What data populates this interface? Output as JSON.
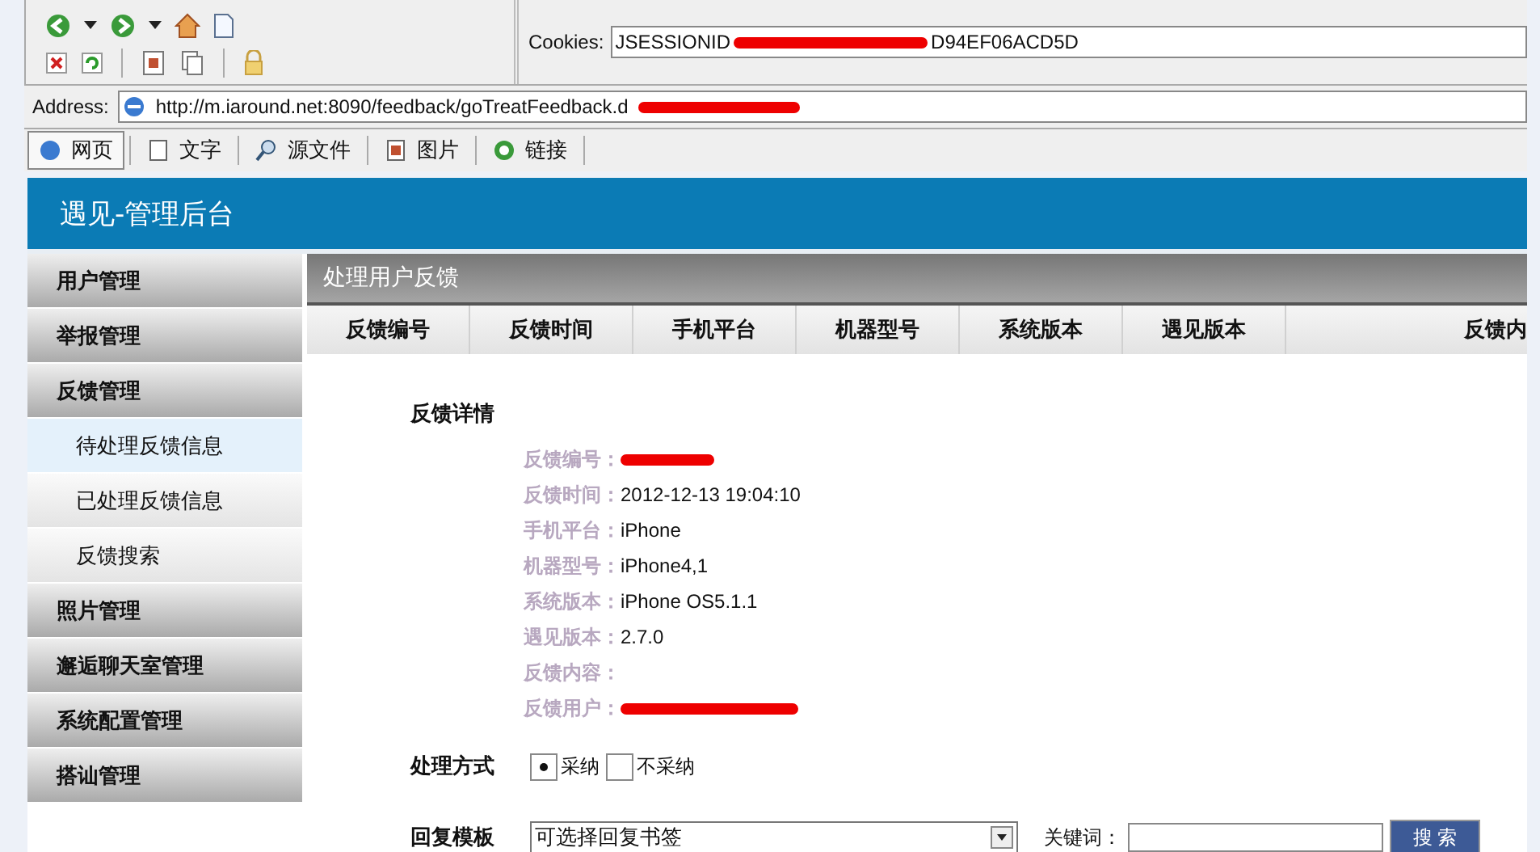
{
  "browser": {
    "cookies_label": "Cookies:",
    "cookies_value_start": "JSESSIONID",
    "cookies_value_end": "D94EF06ACD5D",
    "address_label": "Address:",
    "address_value": "http://m.iaround.net:8090/feedback/goTreatFeedback.d",
    "view_tabs": [
      {
        "label": "网页",
        "selected": true,
        "kind": "page"
      },
      {
        "label": "文字",
        "selected": false,
        "kind": "text"
      },
      {
        "label": "源文件",
        "selected": false,
        "kind": "source"
      },
      {
        "label": "图片",
        "selected": false,
        "kind": "image"
      },
      {
        "label": "链接",
        "selected": false,
        "kind": "link"
      }
    ]
  },
  "header": {
    "title": "遇见-管理后台"
  },
  "sidebar": {
    "items": [
      {
        "label": "用户管理",
        "kind": "group",
        "selected": false
      },
      {
        "label": "举报管理",
        "kind": "group",
        "selected": false
      },
      {
        "label": "反馈管理",
        "kind": "group",
        "selected": false
      },
      {
        "label": "待处理反馈信息",
        "kind": "subitem",
        "selected": true
      },
      {
        "label": "已处理反馈信息",
        "kind": "subitem",
        "selected": false
      },
      {
        "label": "反馈搜索",
        "kind": "subitem",
        "selected": false
      },
      {
        "label": "照片管理",
        "kind": "group",
        "selected": false
      },
      {
        "label": "邂逅聊天室管理",
        "kind": "group",
        "selected": false
      },
      {
        "label": "系统配置管理",
        "kind": "group",
        "selected": false
      },
      {
        "label": "搭讪管理",
        "kind": "group",
        "selected": false
      }
    ]
  },
  "panel": {
    "title": "处理用户反馈",
    "columns": [
      "反馈编号",
      "反馈时间",
      "手机平台",
      "机器型号",
      "系统版本",
      "遇见版本",
      "反馈内"
    ],
    "detail_title": "反馈详情",
    "details": [
      {
        "label": "反馈编号：",
        "kind": "redacted"
      },
      {
        "label": "反馈时间：",
        "kind": "text",
        "value": "2012-12-13 19:04:10"
      },
      {
        "label": "手机平台：",
        "kind": "text",
        "value": "iPhone"
      },
      {
        "label": "机器型号：",
        "kind": "text",
        "value": "iPhone4,1"
      },
      {
        "label": "系统版本：",
        "kind": "text",
        "value": "iPhone OS5.1.1"
      },
      {
        "label": "遇见版本：",
        "kind": "text",
        "value": "2.7.0"
      },
      {
        "label": "反馈内容：",
        "kind": "empty"
      },
      {
        "label": "反馈用户：",
        "kind": "redacted"
      }
    ],
    "handling_label": "处理方式",
    "handling_options": [
      {
        "label": "采纳",
        "selected": true
      },
      {
        "label": "不采纳",
        "selected": false
      }
    ],
    "reply_label": "回复模板",
    "reply_select": "可选择回复书签",
    "keyword_label": "关键词：",
    "search_button": "搜 索"
  }
}
